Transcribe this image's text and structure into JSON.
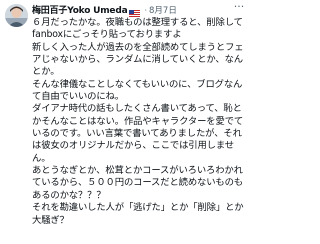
{
  "post": {
    "author_name": "梅田百子Yoko Umeda",
    "author_handle": "",
    "date": "8月7日",
    "separator": "·",
    "more_label": "···",
    "flag_icon": "us-flag-icon",
    "body": "６月だったかな。夜職ものは整理すると、削除して fanboxにごっそり貼っておりますよ\n新しく入った人が過去のを全部読めてしまうとフェアじゃないから、ランダムに消していくとか、なんとか。\nそんな律儀なことしなくてもいいのに、ブログなんて自由でいいのにね。\nダイアナ時代の話もしたくさん書いてあって、恥とかそんなことはない。作品やキャラクターを愛でているのです。いい言葉で書いてありましたが、それは彼女のオリジナルだから、ここでは引用しません。\nあとうなぎとか、松茸とかコースがいろいろわかれているから、５００円のコースだと読めないものもあるのかな？？？\nそれを勘違いした人が「逃げた」とか「削除」とか大騒ぎ？"
  }
}
